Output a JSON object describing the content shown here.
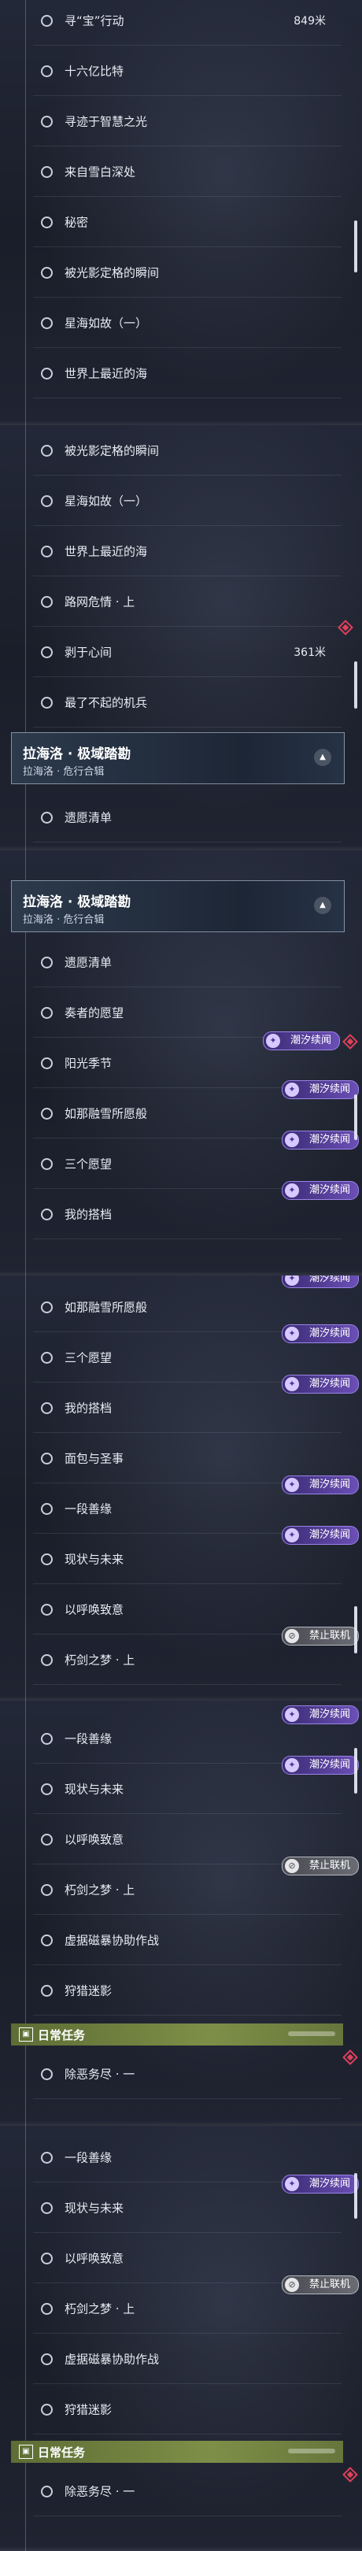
{
  "strips": [
    {
      "rows": [
        {
          "label": "寻“宝”行动",
          "distance": "849米"
        },
        {
          "label": "十六亿比特"
        },
        {
          "label": "寻迹于智慧之光"
        },
        {
          "label": "来自雪白深处"
        },
        {
          "label": "秘密"
        },
        {
          "label": "被光影定格的瞬间"
        },
        {
          "label": "星海如故（一）"
        },
        {
          "label": "世界上最近的海"
        }
      ]
    },
    {
      "rows": [
        {
          "label": "被光影定格的瞬间"
        },
        {
          "label": "星海如故（一）"
        },
        {
          "label": "世界上最近的海"
        },
        {
          "label": "路网危情 · 上"
        },
        {
          "label": "剥于心间",
          "distance": "361米"
        },
        {
          "label": "最了不起的机兵"
        }
      ],
      "header": {
        "title": "拉海洛 · 极域踏勘",
        "subtitle": "拉海洛 · 危行合辑"
      },
      "rows_after": [
        {
          "label": "遗愿清单"
        }
      ]
    },
    {
      "header": {
        "title": "拉海洛 · 极域踏勘",
        "subtitle": "拉海洛 · 危行合辑"
      },
      "rows": [
        {
          "label": "遗愿清单"
        },
        {
          "label": "奏者的愿望"
        },
        {
          "label": "阳光季节",
          "badge": "潮汐续闻"
        },
        {
          "label": "如那融雪所愿般",
          "badge": "潮汐续闻"
        },
        {
          "label": "三个愿望",
          "badge": "潮汐续闻"
        },
        {
          "label": "我的搭档",
          "badge": "潮汐续闻"
        }
      ]
    },
    {
      "rows": [
        {
          "label": "如那融雪所愿般",
          "badge": "潮汐续闻"
        },
        {
          "label": "三个愿望",
          "badge": "潮汐续闻"
        },
        {
          "label": "我的搭档",
          "badge": "潮汐续闻"
        },
        {
          "label": "面包与圣事"
        },
        {
          "label": "一段善缘",
          "badge": "潮汐续闻"
        },
        {
          "label": "现状与未来",
          "badge": "潮汐续闻"
        },
        {
          "label": "以呼唤致意"
        },
        {
          "label": "朽剑之梦 · 上",
          "badge": "禁止联机",
          "badge_gray": true
        }
      ]
    },
    {
      "rows": [
        {
          "label": "一段善缘",
          "badge": "潮汐续闻"
        },
        {
          "label": "现状与未来",
          "badge": "潮汐续闻"
        },
        {
          "label": "以呼唤致意"
        },
        {
          "label": "朽剑之梦 · 上",
          "badge": "禁止联机",
          "badge_gray": true
        },
        {
          "label": "虚据磁暴协助作战"
        },
        {
          "label": "狩猎迷影"
        }
      ],
      "daily": {
        "title": "日常任务"
      },
      "rows_after": [
        {
          "label": "除恶务尽 · 一"
        }
      ]
    },
    {
      "rows": [
        {
          "label": "一段善缘"
        },
        {
          "label": "现状与未来",
          "badge": "潮汐续闻"
        },
        {
          "label": "以呼唤致意"
        },
        {
          "label": "朽剑之梦 · 上",
          "badge": "禁止联机",
          "badge_gray": true
        },
        {
          "label": "虚据磁暴协助作战"
        },
        {
          "label": "狩猎迷影"
        }
      ],
      "daily": {
        "title": "日常任务"
      },
      "rows_after": [
        {
          "label": "除恶务尽 · 一"
        }
      ]
    }
  ],
  "icons": {
    "quest_status": "circle-icon",
    "tide_badge": "tide-badge-icon",
    "no_coop_badge": "no-coop-badge-icon",
    "tracked_marker": "red-diamond-marker-icon",
    "collapse": "chevron-up-icon",
    "daily": "daily-task-icon"
  },
  "colors": {
    "tide_badge": "#6b4fb6",
    "no_coop_badge": "#6a6c74",
    "daily_bar": "#7d8f47",
    "marker": "#e0405a"
  }
}
